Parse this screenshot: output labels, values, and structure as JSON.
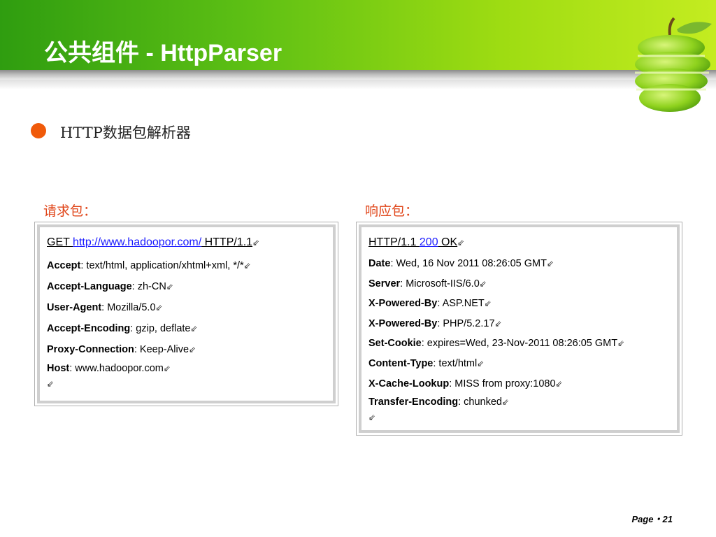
{
  "slide": {
    "title": "公共组件 - HttpParser",
    "bullet": "HTTP数据包解析器",
    "page_label": "Page・21"
  },
  "request": {
    "label": "请求包：",
    "method": "GET ",
    "url": "http://www.hadoopor.com/",
    "protocol": " HTTP/1.1",
    "headers": [
      {
        "name": "Accept",
        "value": ": text/html, application/xhtml+xml, */*"
      },
      {
        "name": "Accept-Language",
        "value": ": zh-CN"
      },
      {
        "name": "User-Agent",
        "value": ": Mozilla/5.0"
      },
      {
        "name": "Accept-Encoding",
        "value": ": gzip, deflate"
      },
      {
        "name": "Proxy-Connection",
        "value": ": Keep-Alive"
      },
      {
        "name": "Host",
        "value": ": www.hadoopor.com"
      }
    ]
  },
  "response": {
    "label": "响应包：",
    "protocol": "HTTP/1.1 ",
    "status_code": "200",
    "status_text": " OK",
    "headers": [
      {
        "name": "Date",
        "value": ": Wed, 16 Nov 2011 08:26:05 GMT"
      },
      {
        "name": "Server",
        "value": ": Microsoft-IIS/6.0"
      },
      {
        "name": "X-Powered-By",
        "value": ": ASP.NET"
      },
      {
        "name": "X-Powered-By",
        "value": ": PHP/5.2.17"
      },
      {
        "name": "Set-Cookie",
        "value": ": expires=Wed, 23-Nov-2011 08:26:05 GMT"
      },
      {
        "name": "Content-Type",
        "value": ": text/html"
      },
      {
        "name": "X-Cache-Lookup",
        "value": ": MISS from proxy:1080"
      },
      {
        "name": "Transfer-Encoding",
        "value": ": chunked"
      }
    ]
  },
  "symbols": {
    "return_mark": "⇙"
  },
  "colors": {
    "accent": "#f05a0a",
    "label": "#e0461a",
    "link": "#1a1aff",
    "header_green": "#5ec014"
  }
}
